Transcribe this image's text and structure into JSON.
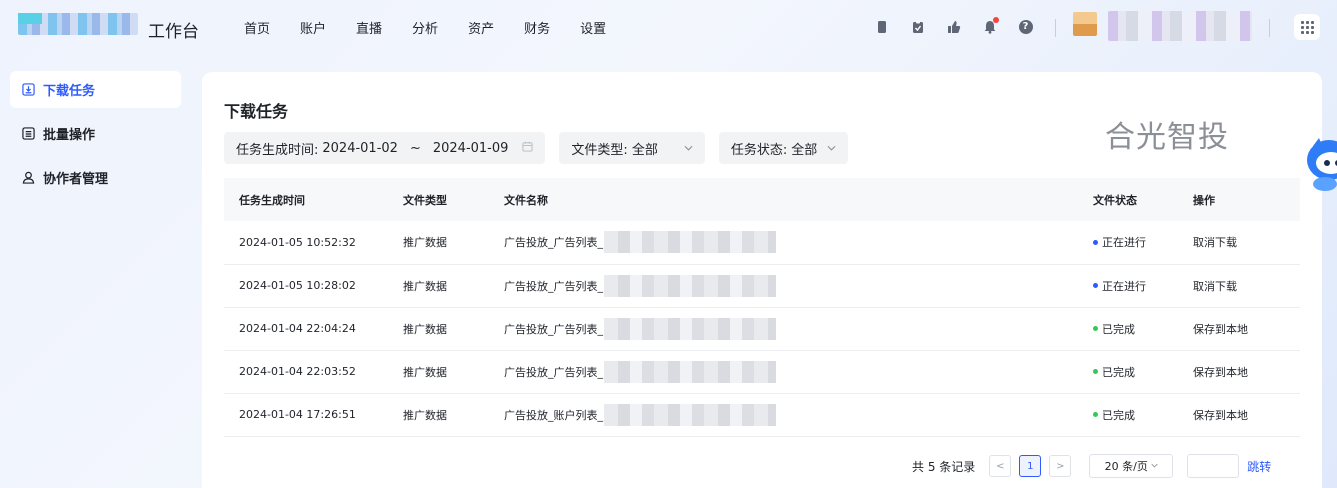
{
  "header": {
    "app_title": "工作台",
    "nav": [
      "首页",
      "账户",
      "直播",
      "分析",
      "资产",
      "财务",
      "设置"
    ],
    "icons": [
      "clipboard-icon",
      "task-icon",
      "thumbs-up-icon",
      "bell-icon",
      "help-icon"
    ],
    "help_glyph": "?"
  },
  "sidebar": {
    "items": [
      {
        "label": "下载任务",
        "icon": "download-icon",
        "active": true
      },
      {
        "label": "批量操作",
        "icon": "list-icon",
        "active": false
      },
      {
        "label": "协作者管理",
        "icon": "user-icon",
        "active": false
      }
    ]
  },
  "main": {
    "title": "下载任务",
    "brand": "合光智投",
    "filters": {
      "date_label": "任务生成时间:",
      "date_start": "2024-01-02",
      "date_sep": "~",
      "date_end": "2024-01-09",
      "type_label": "文件类型:",
      "type_value": "全部",
      "status_label": "任务状态:",
      "status_value": "全部"
    },
    "table": {
      "columns": [
        "任务生成时间",
        "文件类型",
        "文件名称",
        "文件状态",
        "操作"
      ],
      "rows": [
        {
          "time": "2024-01-05 10:52:32",
          "type": "推广数据",
          "name": "广告投放_广告列表_",
          "status": "正在进行",
          "status_color": "#2e5bff",
          "action": "取消下载"
        },
        {
          "time": "2024-01-05 10:28:02",
          "type": "推广数据",
          "name": "广告投放_广告列表_",
          "status": "正在进行",
          "status_color": "#2e5bff",
          "action": "取消下载"
        },
        {
          "time": "2024-01-04 22:04:24",
          "type": "推广数据",
          "name": "广告投放_广告列表_",
          "status": "已完成",
          "status_color": "#34c759",
          "action": "保存到本地"
        },
        {
          "time": "2024-01-04 22:03:52",
          "type": "推广数据",
          "name": "广告投放_广告列表_",
          "status": "已完成",
          "status_color": "#34c759",
          "action": "保存到本地"
        },
        {
          "time": "2024-01-04 17:26:51",
          "type": "推广数据",
          "name": "广告投放_账户列表_",
          "status": "已完成",
          "status_color": "#34c759",
          "action": "保存到本地"
        }
      ]
    },
    "pagination": {
      "total": "共 5 条记录",
      "prev": "<",
      "current": "1",
      "next": ">",
      "page_size": "20 条/页",
      "jump": "跳转"
    }
  },
  "colors": {
    "accent": "#2e5bff",
    "success": "#34c759"
  }
}
